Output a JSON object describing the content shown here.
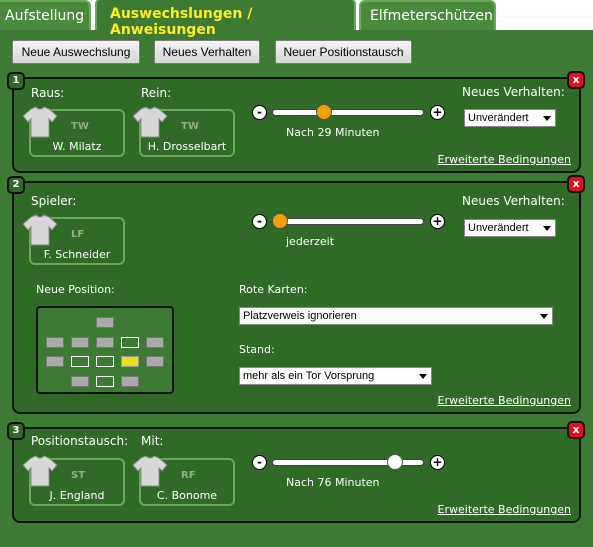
{
  "tabs": [
    {
      "label": "Aufstellung"
    },
    {
      "label": "Auswechslungen / Anweisungen"
    },
    {
      "label": "Elfmeterschützen"
    }
  ],
  "toolbar": {
    "new_substitution": "Neue Auswechslung",
    "new_behaviour": "Neues Verhalten",
    "new_position_swap": "Neuer Positionstausch"
  },
  "panels": [
    {
      "number": "1",
      "close": "x",
      "out_label": "Raus:",
      "in_label": "Rein:",
      "player_out": {
        "position": "TW",
        "name": "W. Milatz"
      },
      "player_in": {
        "position": "TW",
        "name": "H. Drosselbart"
      },
      "slider_caption": "Nach 29 Minuten",
      "slider_value": 29,
      "slider_max": 90,
      "knob_color": "#f0a000",
      "minus": "-",
      "plus": "+",
      "behaviour_label": "Neues Verhalten:",
      "behaviour_value": "Unverändert",
      "advanced_link": "Erweiterte Bedingungen"
    },
    {
      "number": "2",
      "close": "x",
      "player_label": "Spieler:",
      "player": {
        "position": "LF",
        "name": "F. Schneider"
      },
      "slider_caption": "jederzeit",
      "slider_value": 0,
      "knob_color": "#f0a000",
      "minus": "-",
      "plus": "+",
      "behaviour_label": "Neues Verhalten:",
      "behaviour_value": "Unverändert",
      "new_position_label": "Neue Position:",
      "red_cards_label": "Rote Karten:",
      "red_cards_value": "Platzverweis ignorieren",
      "score_label": "Stand:",
      "score_value": "mehr als ein Tor Vorsprung",
      "advanced_link": "Erweiterte Bedingungen"
    },
    {
      "number": "3",
      "close": "x",
      "swap_label": "Positionstausch:",
      "with_label": "Mit:",
      "player_a": {
        "position": "ST",
        "name": "J. England"
      },
      "player_b": {
        "position": "RF",
        "name": "C. Bonome"
      },
      "slider_caption": "Nach 76 Minuten",
      "slider_value": 76,
      "slider_max": 90,
      "knob_color": "#ffffff",
      "minus": "-",
      "plus": "+",
      "advanced_link": "Erweiterte Bedingungen"
    }
  ],
  "colors": {
    "background": "#3d7a33",
    "panel": "#2f6a27",
    "active_tab_text": "#ffee22",
    "close_button": "#e0101a",
    "selected_position": "#e6e01a"
  }
}
